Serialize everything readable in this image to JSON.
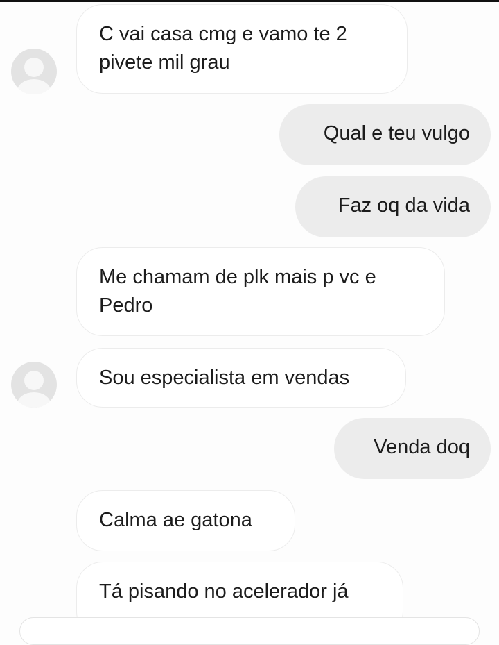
{
  "conversation": {
    "messages": [
      {
        "direction": "incoming",
        "text": "C vai casa cmg e vamo te 2\npivete mil grau"
      },
      {
        "direction": "outgoing",
        "text": "Qual e teu vulgo"
      },
      {
        "direction": "outgoing",
        "text": "Faz oq da vida"
      },
      {
        "direction": "incoming",
        "text": "Me chamam de plk mais p vc e\nPedro"
      },
      {
        "direction": "incoming",
        "text": "Sou especialista em vendas"
      },
      {
        "direction": "outgoing",
        "text": "Venda doq"
      },
      {
        "direction": "incoming",
        "text": "Calma ae gatona"
      },
      {
        "direction": "incoming",
        "text": "Tá pisando no acelerador já"
      }
    ]
  },
  "icons": {
    "avatar": "user-avatar-placeholder-icon"
  },
  "colors": {
    "incoming_bubble": "#ffffff",
    "incoming_border": "#ececec",
    "outgoing_bubble": "#ececec",
    "text": "#1c1c1c",
    "background": "#fdfdfd"
  }
}
